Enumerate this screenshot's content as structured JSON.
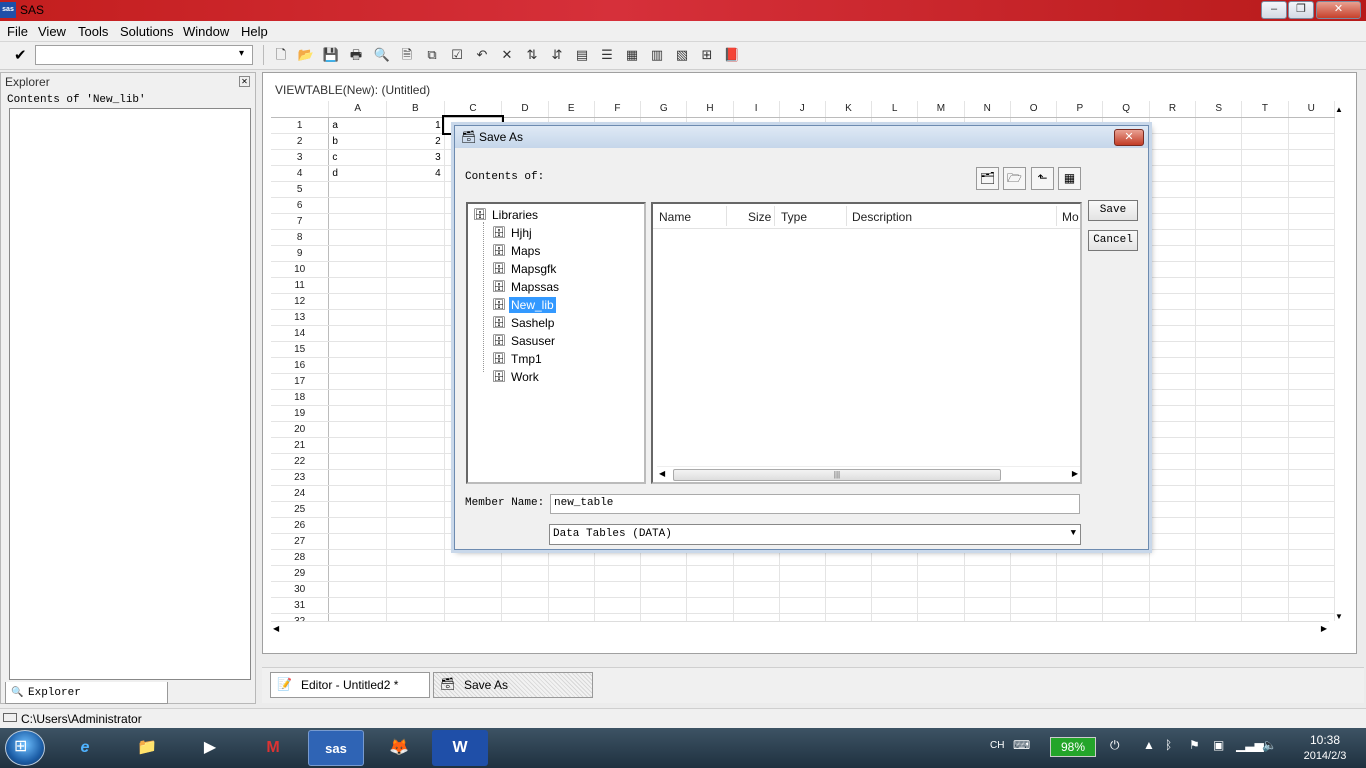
{
  "app": {
    "title": "SAS",
    "icon_text": "sas",
    "window_buttons": [
      "–",
      "❐",
      "✕"
    ]
  },
  "menu": [
    "File",
    "View",
    "Tools",
    "Solutions",
    "Window",
    "Help"
  ],
  "toolbar": {
    "command_value": "",
    "icons": [
      "new-icon",
      "open-icon",
      "save-icon",
      "print-icon",
      "print-preview-icon",
      "print-setup-icon",
      "copy-icon",
      "check-icon",
      "undo-icon",
      "delete-icon",
      "sort-ascending-icon",
      "sort-descending-icon",
      "table-attributes-icon",
      "column-list-icon",
      "form-view-icon",
      "table-view-icon",
      "hide-icon",
      "zoom-icon",
      "help-book-icon"
    ]
  },
  "explorer": {
    "title": "Explorer",
    "contents_label": "Contents of 'New_lib'",
    "tab_label": "Explorer"
  },
  "viewtable": {
    "title": "VIEWTABLE(New): (Untitled)",
    "columns": [
      "A",
      "B",
      "C",
      "D",
      "E",
      "F",
      "G",
      "H",
      "I",
      "J",
      "K",
      "L",
      "M",
      "N",
      "O",
      "P",
      "Q",
      "R",
      "S",
      "T",
      "U"
    ],
    "rows": [
      [
        "a",
        "1"
      ],
      [
        "b",
        "2"
      ],
      [
        "c",
        "3"
      ],
      [
        "d",
        "4"
      ]
    ],
    "row_count": 32
  },
  "dialog": {
    "title": "Save As",
    "contents_label": "Contents of:",
    "tree_root": "Libraries",
    "libraries": [
      "Hjhj",
      "Maps",
      "Mapsgfk",
      "Mapssas",
      "New_lib",
      "Sashelp",
      "Sasuser",
      "Tmp1",
      "Work"
    ],
    "selected_library": "New_lib",
    "list_columns": [
      "Name",
      "Size",
      "Type",
      "Description",
      "Mo"
    ],
    "save_label": "Save",
    "cancel_label": "Cancel",
    "member_label": "Member Name:",
    "member_value": "new_table",
    "type_value": "Data Tables (DATA)"
  },
  "sas_tasks": [
    {
      "label": "Editor - Untitled2 *"
    },
    {
      "label": "Save As"
    }
  ],
  "status": {
    "path": "C:\\Users\\Administrator"
  },
  "taskbar": {
    "apps": [
      "e",
      "📁",
      "▶",
      "M",
      "sas",
      "🦊",
      "W"
    ],
    "lang": "CH",
    "battery": "98%",
    "time": "10:38",
    "date": "2014/2/3"
  },
  "colors": {
    "title_red": "#c31e1e",
    "selection_blue": "#3399ff",
    "battery_green": "#24a52a"
  }
}
